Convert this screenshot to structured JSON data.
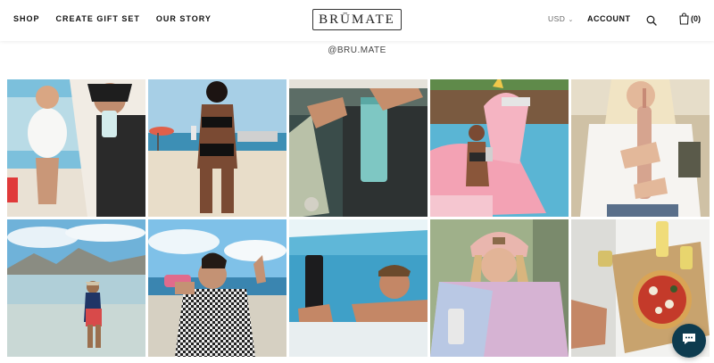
{
  "nav": {
    "left": [
      "SHOP",
      "CREATE GIFT SET",
      "OUR STORY"
    ],
    "logo": "BRŪMATE",
    "currency": "USD",
    "account": "ACCOUNT",
    "cart_count": "(0)"
  },
  "instagram": {
    "handle": "@BRU.MATE",
    "tiles": [
      {
        "subject": "friends drinking at the beach"
      },
      {
        "subject": "woman in black bikini on beach"
      },
      {
        "subject": "hands holding mint tumbler with skateboard"
      },
      {
        "subject": "woman on pink unicorn pool float"
      },
      {
        "subject": "woman holding rose gold bottle"
      },
      {
        "subject": "woman standing in lake with mountains"
      },
      {
        "subject": "woman drinking from pink can cooler"
      },
      {
        "subject": "man in pool holding black can cooler"
      },
      {
        "subject": "smiling woman in pink beanie with cup"
      },
      {
        "subject": "pizza box with drinks from above"
      }
    ]
  },
  "icons": {
    "search": "search-icon",
    "cart": "bag-icon",
    "chat": "chat-icon",
    "currency_chevron": "chevron-down-icon"
  },
  "colors": {
    "chat_bubble": "#0d3b4f"
  }
}
